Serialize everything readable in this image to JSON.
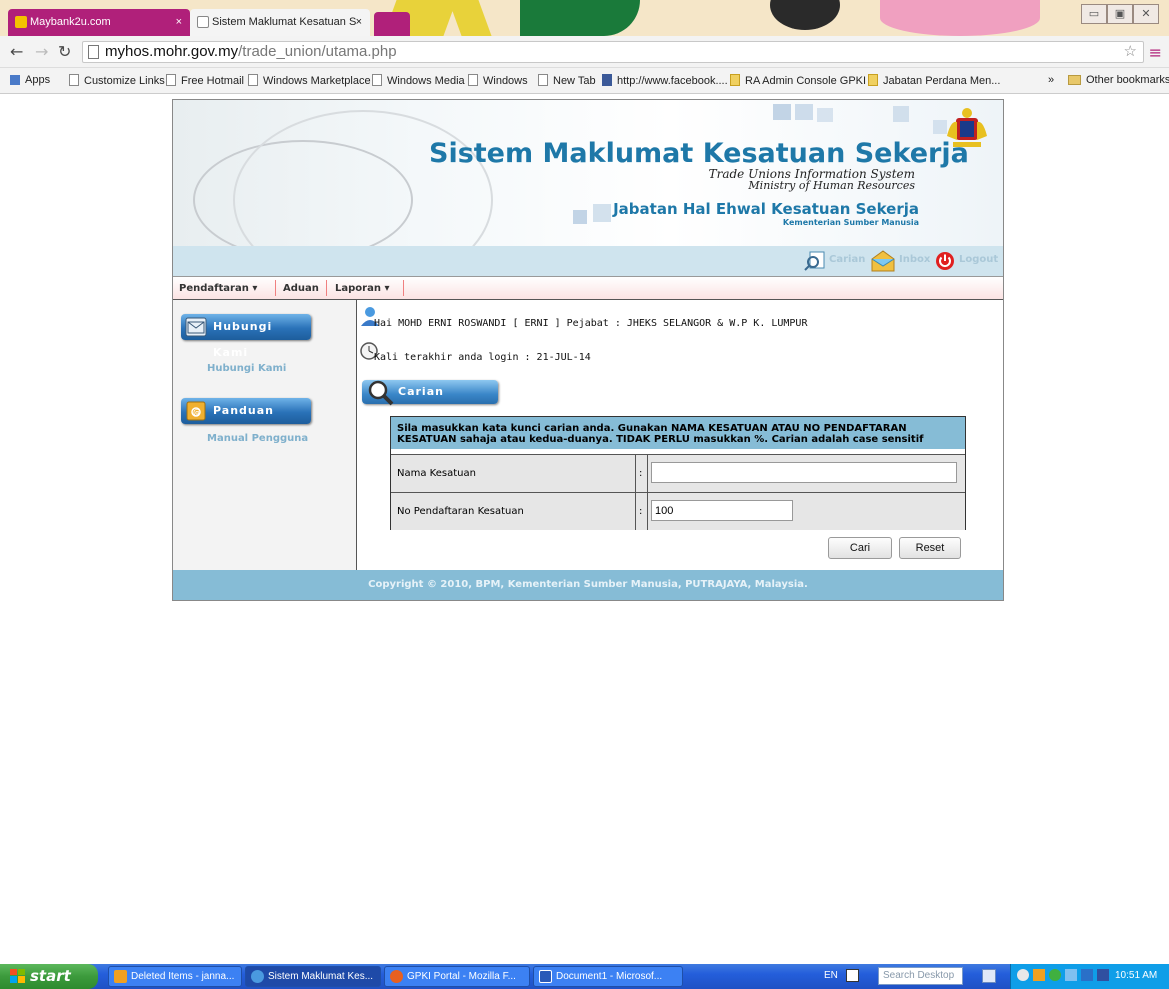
{
  "browser": {
    "tabs": [
      {
        "label": "Maybank2u.com"
      },
      {
        "label": "Sistem Maklumat Kesatuan S"
      }
    ],
    "address": {
      "host": "myhos.mohr.gov.my",
      "path": "/trade_union/utama.php"
    },
    "bookmarks": [
      "Apps",
      "Customize Links",
      "Free Hotmail",
      "Windows Marketplace",
      "Windows Media",
      "Windows",
      "New Tab",
      "http://www.facebook....",
      "RA Admin Console GPKI",
      "Jabatan Perdana Men...",
      "»",
      "Other bookmarks"
    ]
  },
  "banner": {
    "title": "Sistem Maklumat Kesatuan Sekerja",
    "subtitle1": "Trade Unions Information System",
    "subtitle2": "Ministry of Human Resources",
    "department": "Jabatan Hal Ehwal Kesatuan Sekerja",
    "ministry": "Kementerian Sumber Manusia"
  },
  "topbar": {
    "search": "Carian",
    "inbox": "Inbox",
    "logout": "Logout"
  },
  "menu": {
    "registration": "Pendaftaran",
    "complaint": "Aduan",
    "report": "Laporan"
  },
  "sidebar": {
    "contact_button": "Hubungi Kami",
    "contact_link": "Hubungi Kami",
    "guide_button": "Panduan",
    "guide_link": "Manual Pengguna"
  },
  "content": {
    "greeting": "Hai MOHD ERNI ROSWANDI [ ERNI ] Pejabat : JHEKS SELANGOR & W.P K. LUMPUR",
    "last_login": "Kali terakhir anda login : 21-JUL-14",
    "search_heading": "Carian",
    "instruction": "Sila masukkan kata kunci carian anda. Gunakan NAMA KESATUAN ATAU NO PENDAFTARAN KESATUAN sahaja atau kedua-duanya. TIDAK PERLU masukkan %. Carian adalah case sensitif",
    "field1_label": "Nama Kesatuan",
    "field1_value": "",
    "field2_label": "No Pendaftaran Kesatuan",
    "field2_value": "100",
    "colon": ":",
    "search_button": "Cari",
    "reset_button": "Reset"
  },
  "footer": {
    "text": "Copyright © 2010, BPM, Kementerian Sumber Manusia, PUTRAJAYA, Malaysia."
  },
  "taskbar": {
    "start": "start",
    "tasks": [
      "Deleted Items - janna...",
      "Sistem Maklumat Kes...",
      "GPKI Portal - Mozilla F...",
      "Document1 - Microsof..."
    ],
    "lang": "EN",
    "search_placeholder": "Search Desktop",
    "clock": "10:51 AM"
  },
  "colors": {
    "accent": "#1e78a8",
    "header_blue": "#86bcd6",
    "tab_active": "#b0207a"
  }
}
